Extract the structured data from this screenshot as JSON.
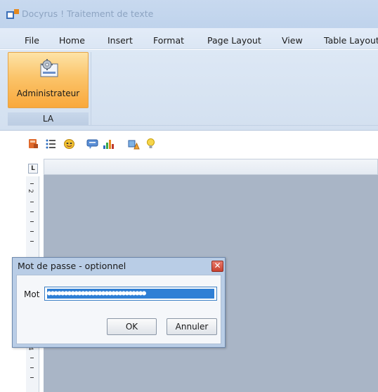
{
  "window": {
    "title": "Docyrus ! Traitement de texte"
  },
  "menu": [
    "File",
    "Home",
    "Insert",
    "Format",
    "Page Layout",
    "View",
    "Table Layout"
  ],
  "ribbon": {
    "button_label": "Administrateur",
    "group_label": "LA"
  },
  "toolbar": {
    "icons": [
      "database-icon",
      "list-icon",
      "mask-icon",
      "comment-icon",
      "bar-chart-icon",
      "shapes-icon",
      "lightbulb-icon"
    ]
  },
  "ruler": {
    "corner": "L",
    "vertical_numbers": [
      "2",
      "4"
    ]
  },
  "dialog": {
    "title": "Mot de passe - optionnel",
    "close": "✕",
    "field_label": "Mot",
    "password_mask": "●●●●●●●●●●●●●●●●●●●●●●●●●●●●●",
    "ok_label": "OK",
    "cancel_label": "Annuler"
  }
}
